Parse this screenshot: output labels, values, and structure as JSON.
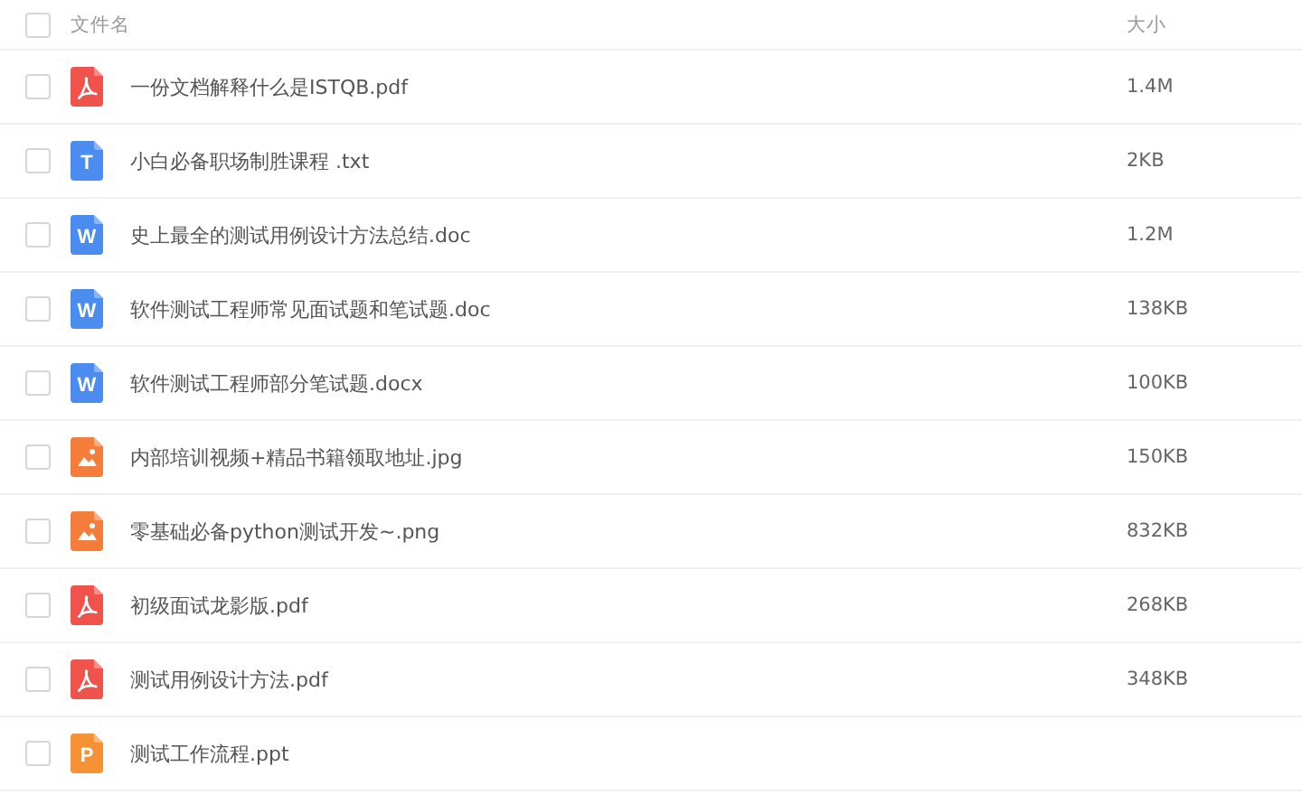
{
  "header": {
    "checked": false,
    "name_label": "文件名",
    "size_label": "大小"
  },
  "files": [
    {
      "kind": "pdf",
      "name": "一份文档解释什么是ISTQB.pdf",
      "size": "1.4M",
      "checked": false
    },
    {
      "kind": "txt",
      "letter": "T",
      "name": "小白必备职场制胜课程 .txt",
      "size": "2KB",
      "checked": false
    },
    {
      "kind": "doc",
      "letter": "W",
      "name": "史上最全的测试用例设计方法总结.doc",
      "size": "1.2M",
      "checked": false
    },
    {
      "kind": "doc",
      "letter": "W",
      "name": "软件测试工程师常见面试题和笔试题.doc",
      "size": "138KB",
      "checked": false
    },
    {
      "kind": "doc",
      "letter": "W",
      "name": "软件测试工程师部分笔试题.docx",
      "size": "100KB",
      "checked": false
    },
    {
      "kind": "image",
      "name": "内部培训视频+精品书籍领取地址.jpg",
      "size": "150KB",
      "checked": false
    },
    {
      "kind": "image",
      "name": "零基础必备python测试开发~.png",
      "size": "832KB",
      "checked": false
    },
    {
      "kind": "pdf",
      "name": "初级面试龙影版.pdf",
      "size": "268KB",
      "checked": false
    },
    {
      "kind": "pdf",
      "name": "测试用例设计方法.pdf",
      "size": "348KB",
      "checked": false
    },
    {
      "kind": "ppt",
      "letter": "P",
      "name": "测试工作流程.ppt",
      "checked": false
    }
  ]
}
